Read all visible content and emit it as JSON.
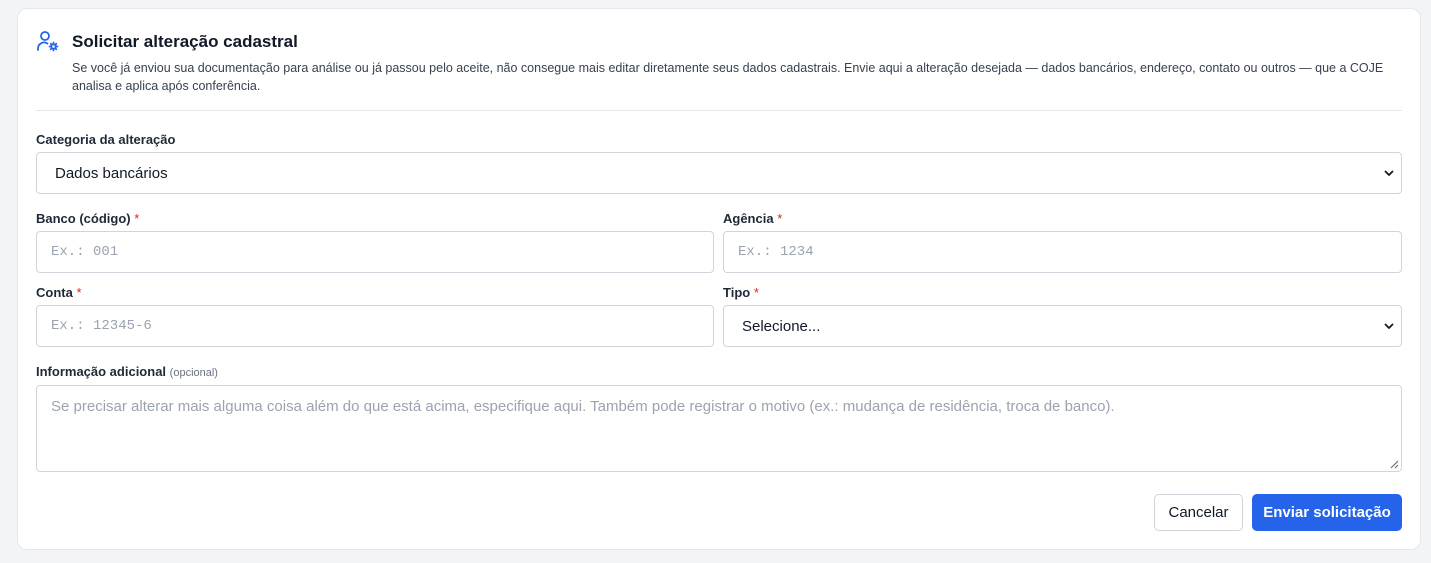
{
  "header": {
    "icon": "user-cog-icon",
    "title": "Solicitar alteração cadastral",
    "description": "Se você já enviou sua documentação para análise ou já passou pelo aceite, não consegue mais editar diretamente seus dados cadastrais. Envie aqui a alteração desejada — dados bancários, endereço, contato ou outros — que a COJE analisa e aplica após conferência."
  },
  "category": {
    "label": "Categoria da alteração",
    "selected": "Dados bancários"
  },
  "bank": {
    "label": "Banco (código)",
    "required": "*",
    "placeholder": "Ex.: 001",
    "value": ""
  },
  "agency": {
    "label": "Agência",
    "required": "*",
    "placeholder": "Ex.: 1234",
    "value": ""
  },
  "account": {
    "label": "Conta",
    "required": "*",
    "placeholder": "Ex.: 12345-6",
    "value": ""
  },
  "type": {
    "label": "Tipo",
    "required": "*",
    "selected": "Selecione..."
  },
  "additional": {
    "label": "Informação adicional",
    "optional": "(opcional)",
    "placeholder": "Se precisar alterar mais alguma coisa além do que está acima, especifique aqui. Também pode registrar o motivo (ex.: mudança de residência, troca de banco).",
    "value": ""
  },
  "actions": {
    "cancel_label": "Cancelar",
    "submit_label": "Enviar solicitação"
  },
  "colors": {
    "accent": "#2563eb",
    "required": "#dc2626",
    "border": "#d1d5db"
  }
}
